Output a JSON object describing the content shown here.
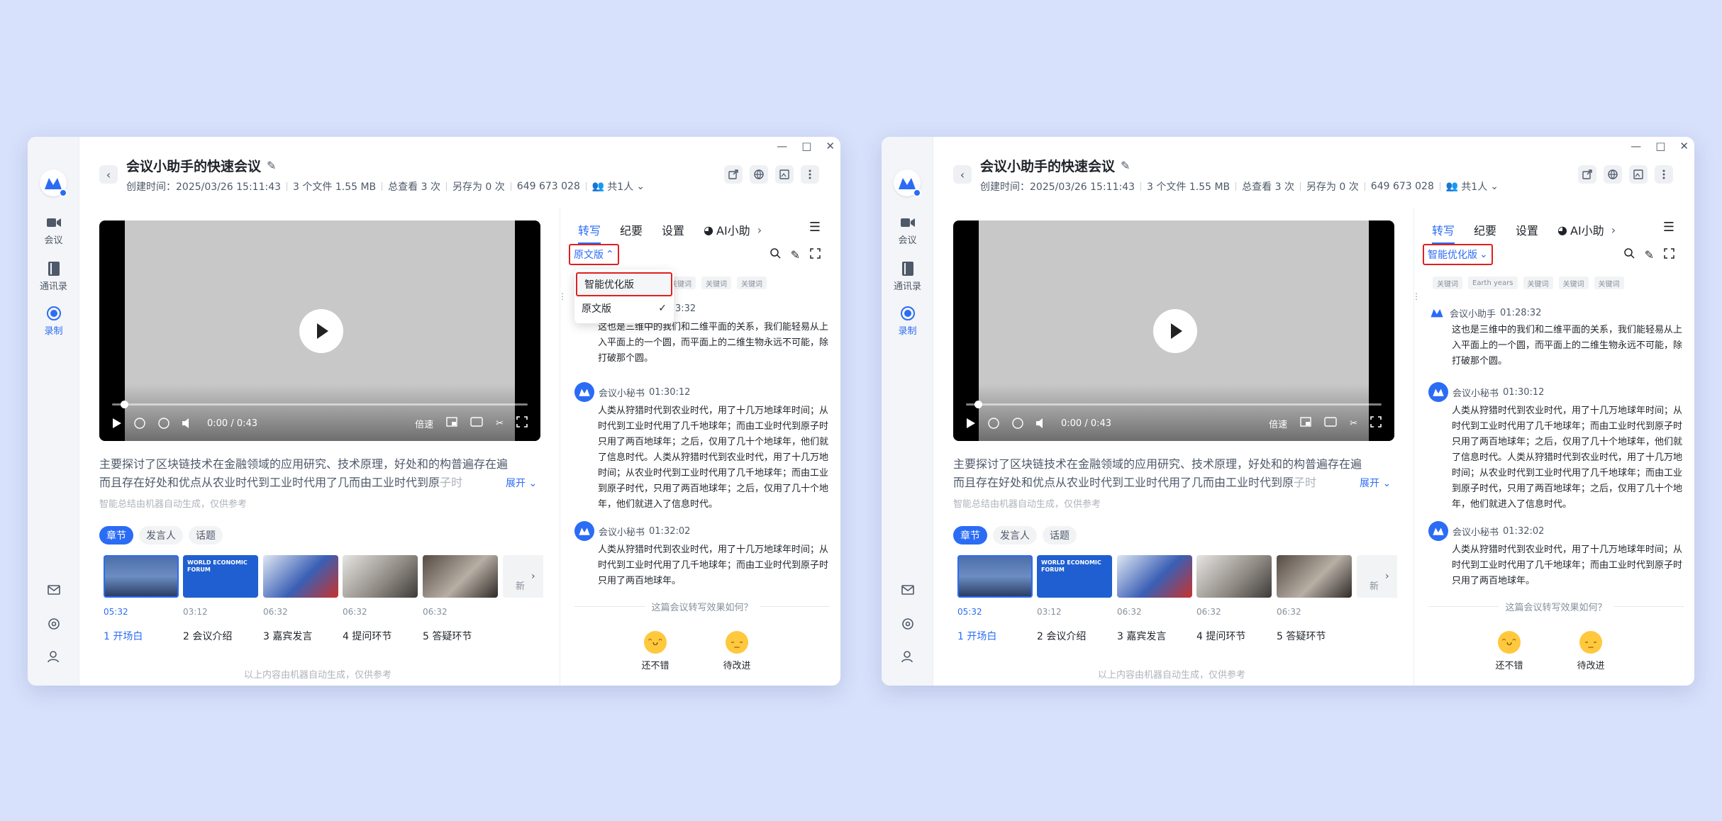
{
  "app": {
    "title": "会议小助手的快速会议",
    "created": "创建时间：2025/03/26 15:11:43",
    "files": "3 个文件 1.55 MB",
    "views": "总查看 3 次",
    "saved": "另存为 0 次",
    "meeting_id": "649 673 028",
    "share": "共1人"
  },
  "nav": {
    "meeting": "会议",
    "contacts": "通讯录",
    "record": "录制"
  },
  "video": {
    "time": "0:00 / 0:43",
    "speed": "倍速",
    "progress": 0.02
  },
  "summary": {
    "line1": "主要探讨了区块链技术在金融领域的应用研究、技术原理，好处和的构普遍存在遍",
    "line2": "而且存在好处和优点从农业时代到工业时代用了几而由工业时代到原",
    "line2_fade": "子时",
    "expand": "展开",
    "ai_note": "智能总结由机器自动生成，仅供参考"
  },
  "chapter_tabs": [
    "章节",
    "发言人",
    "话题"
  ],
  "chapters": [
    {
      "time": "05:32",
      "name": "1 开场白"
    },
    {
      "time": "03:12",
      "name": "2 会议介绍"
    },
    {
      "time": "06:32",
      "name": "3 嘉宾发言"
    },
    {
      "time": "06:32",
      "name": "4 提问环节"
    },
    {
      "time": "06:32",
      "name": "5 答疑环节"
    }
  ],
  "thumb_more": "新",
  "thumb_forum": "WORLD ECONOMIC FORUM",
  "footnote": "以上内容由机器自动生成，仅供参考",
  "right_tabs": {
    "transcribe": "转写",
    "minutes": "纪要",
    "settings": "设置",
    "ai": "AI小助"
  },
  "left_window": {
    "version": "原文版",
    "keywords": [
      "关键词",
      "关键词",
      "关键词"
    ],
    "dropdown": {
      "opt1": "智能优化版",
      "opt2": "原文版"
    },
    "first_time": "3:32"
  },
  "right_window": {
    "version": "智能优化版",
    "keywords": [
      "关键词",
      "Earth years",
      "关键词",
      "关键词",
      "关键词"
    ]
  },
  "transcript": [
    {
      "speaker": "会议小助手",
      "time": "01:28:32",
      "text": "这也是三维中的我们和二维平面的关系，我们能轻易从上入平面上的一个圆，而平面上的二维生物永远不可能，除打破那个圆。"
    },
    {
      "speaker": "会议小秘书",
      "time": "01:30:12",
      "text": "人类从狩猎时代到农业时代，用了十几万地球年时间；从时代到工业时代用了几千地球年；而由工业时代到原子时只用了两百地球年；之后，仅用了几十个地球年，他们就了信息时代。人类从狩猎时代到农业时代，用了十几万地时间；从农业时代到工业时代用了几千地球年；而由工业到原子时代，只用了两百地球年；之后，仅用了几十个地年，他们就进入了信息时代。"
    },
    {
      "speaker": "会议小秘书",
      "time": "01:32:02",
      "text": "人类从狩猎时代到农业时代，用了十几万地球年时间；从时代到工业时代用了几千地球年；而由工业时代到原子时只用了两百地球年。"
    }
  ],
  "feedback": {
    "question": "这篇会议转写效果如何？",
    "good": "还不错",
    "bad": "待改进"
  },
  "colors": {
    "accent": "#2b6cf5",
    "highlight": "#e02020",
    "background": "#d7e1fb"
  }
}
